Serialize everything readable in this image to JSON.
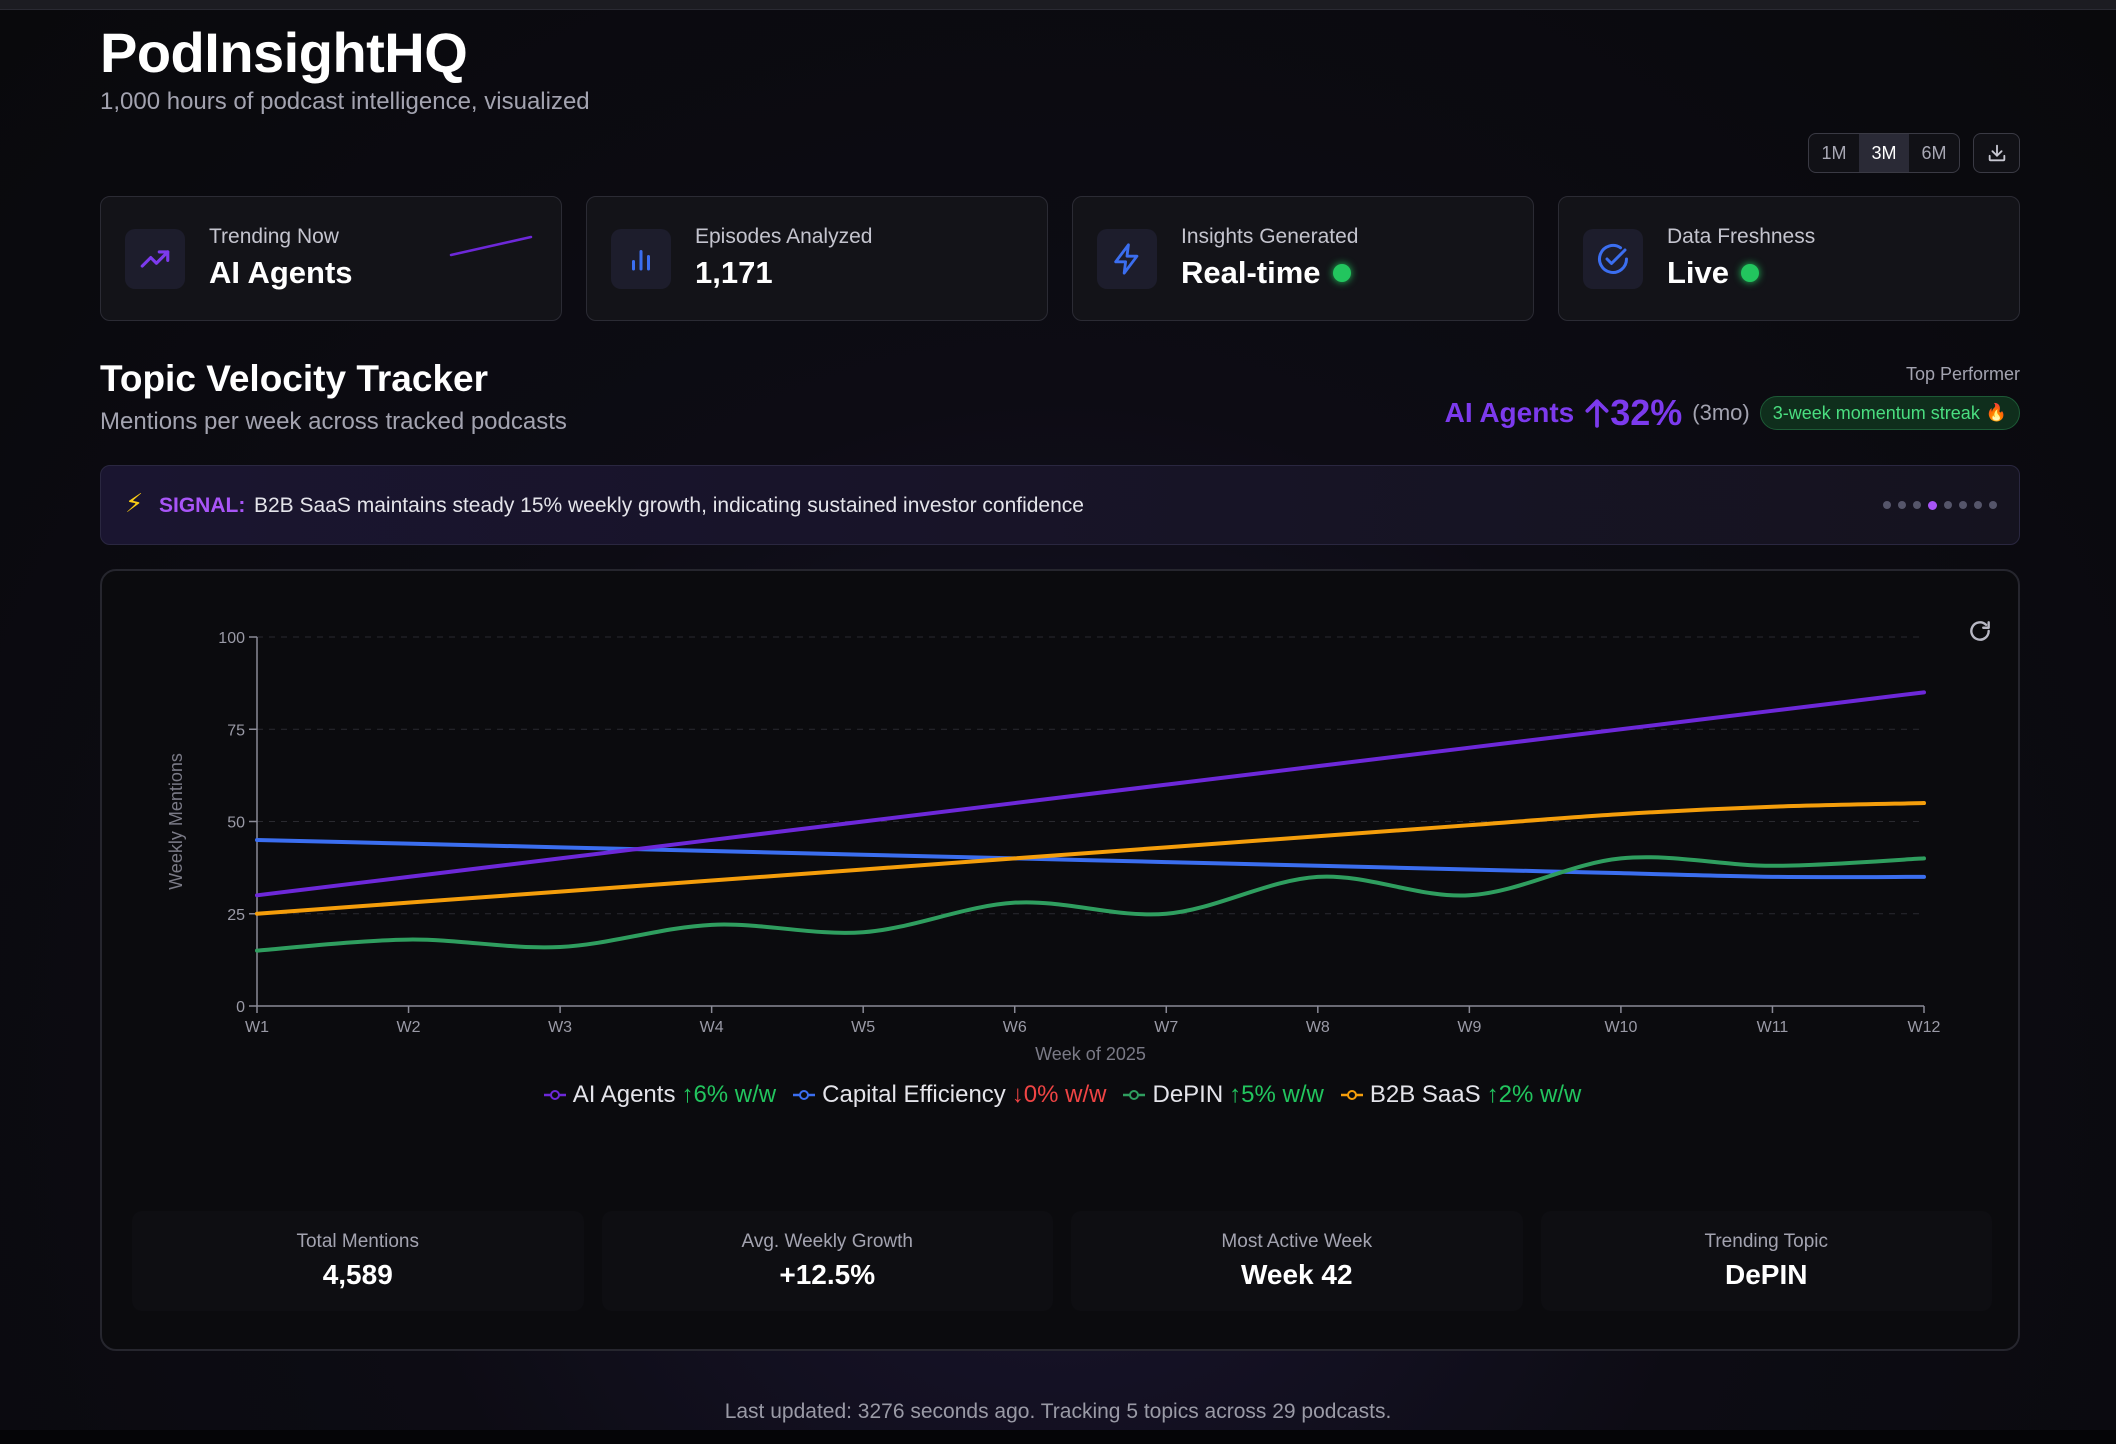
{
  "app": {
    "title": "PodInsightHQ",
    "subtitle": "1,000 hours of podcast intelligence, visualized"
  },
  "range": {
    "options": [
      "1M",
      "3M",
      "6M"
    ],
    "selected": "3M"
  },
  "cards": [
    {
      "label": "Trending Now",
      "value": "AI Agents",
      "icon": "trending-up-icon"
    },
    {
      "label": "Episodes Analyzed",
      "value": "1,171",
      "icon": "bar-chart-icon"
    },
    {
      "label": "Insights Generated",
      "value": "Real-time",
      "icon": "lightning-icon",
      "live": true
    },
    {
      "label": "Data Freshness",
      "value": "Live",
      "icon": "check-circle-icon",
      "live": true
    }
  ],
  "section": {
    "title": "Topic Velocity Tracker",
    "subtitle": "Mentions per week across tracked podcasts"
  },
  "top_performer": {
    "label": "Top Performer",
    "topic": "AI Agents",
    "change": "32%",
    "period": "(3mo)",
    "streak": "3-week momentum streak"
  },
  "signal": {
    "label": "SIGNAL:",
    "text": "B2B SaaS maintains steady 15% weekly growth, indicating sustained investor confidence",
    "dot_count": 8,
    "active_dot": 3
  },
  "chart_data": {
    "type": "line",
    "x": [
      "W1",
      "W2",
      "W3",
      "W4",
      "W5",
      "W6",
      "W7",
      "W8",
      "W9",
      "W10",
      "W11",
      "W12"
    ],
    "xlabel": "Week of 2025",
    "ylabel": "Weekly Mentions",
    "ylim": [
      0,
      100
    ],
    "yticks": [
      0,
      25,
      50,
      75,
      100
    ],
    "grid": true,
    "legend": "bottom",
    "series": [
      {
        "name": "AI Agents",
        "color": "#6d28d9",
        "change": "6% w/w",
        "direction": "up",
        "values": [
          30,
          35,
          40,
          45,
          50,
          55,
          60,
          65,
          70,
          75,
          80,
          85
        ]
      },
      {
        "name": "Capital Efficiency",
        "color": "#3b6ef0",
        "change": "0% w/w",
        "direction": "down",
        "values": [
          45,
          44,
          43,
          42,
          41,
          40,
          39,
          38,
          37,
          36,
          35,
          35
        ]
      },
      {
        "name": "DePIN",
        "color": "#2f9e5f",
        "change": "5% w/w",
        "direction": "up",
        "values": [
          15,
          18,
          16,
          22,
          20,
          28,
          25,
          35,
          30,
          40,
          38,
          40
        ]
      },
      {
        "name": "B2B SaaS",
        "color": "#f59e0b",
        "change": "2% w/w",
        "direction": "up",
        "values": [
          25,
          28,
          31,
          34,
          37,
          40,
          43,
          46,
          49,
          52,
          54,
          55
        ]
      }
    ]
  },
  "summary": [
    {
      "label": "Total Mentions",
      "value": "4,589"
    },
    {
      "label": "Avg. Weekly Growth",
      "value": "+12.5%"
    },
    {
      "label": "Most Active Week",
      "value": "Week 42"
    },
    {
      "label": "Trending Topic",
      "value": "DePIN"
    }
  ],
  "footer": "Last updated: 3276 seconds ago. Tracking 5 topics across 29 podcasts."
}
